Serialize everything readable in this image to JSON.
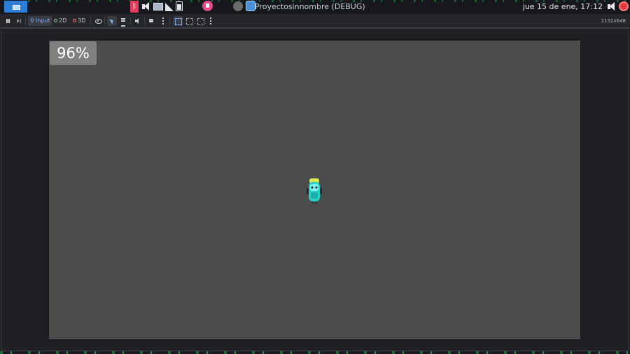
{
  "taskbar": {
    "window_title": "Proyectosinnombre (DEBUG)",
    "clock": "jue 15 de ene, 17:12",
    "icons": [
      "launcher-icon",
      "bluetooth-icon",
      "volume-icon",
      "network-icon",
      "signal-icon",
      "battery-icon",
      "recorder-icon",
      "godot-icon",
      "window-icon",
      "volume-icon",
      "power-icon"
    ]
  },
  "toolbar": {
    "input_label": "Input",
    "mode_2d_label": "2D",
    "mode_3d_label": "3D",
    "resolution": "1152x648"
  },
  "game": {
    "fps_percent": "96%",
    "background_color": "#4c4c4c",
    "sprite": "cyan-character-sprite"
  },
  "colors": {
    "accent": "#2d7ed6",
    "active_tool": "#7eb4ff",
    "mode_2d": "#8fdc9a",
    "mode_3d": "#ff7b7b"
  }
}
